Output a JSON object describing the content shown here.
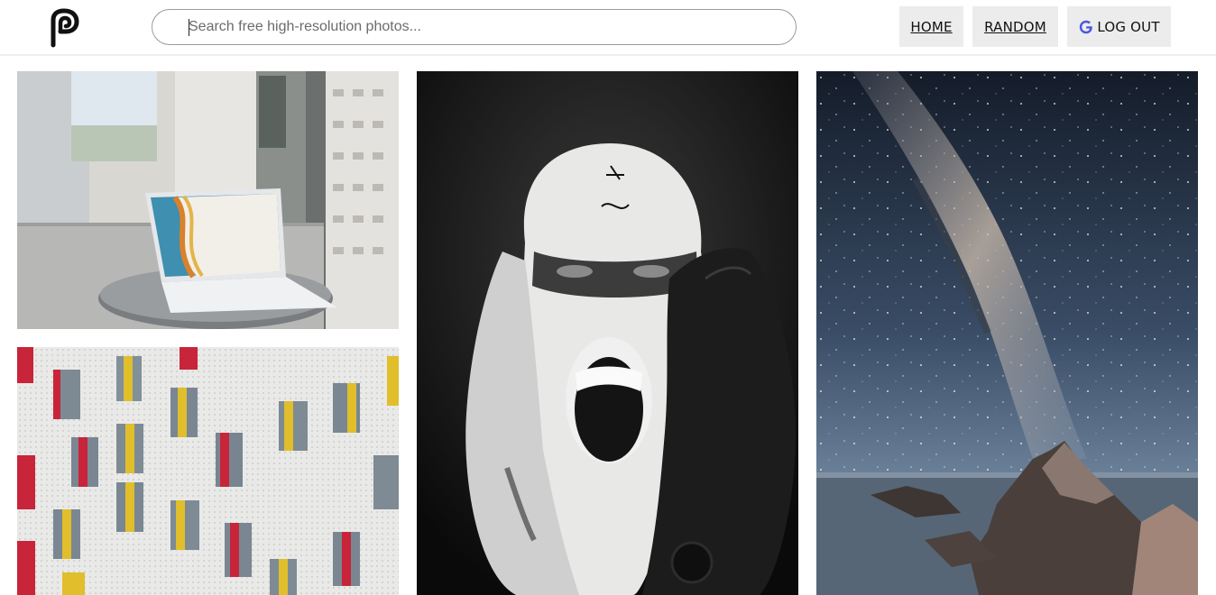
{
  "header": {
    "logo_icon": "p-letter-logo-icon",
    "search": {
      "placeholder": "Search free high-resolution photos..."
    },
    "nav": {
      "home_label": "HOME",
      "random_label": "RANDOM",
      "logout_label": "LOG OUT",
      "logout_icon": "google-g-icon"
    }
  },
  "gallery": {
    "photos": [
      {
        "subject": "laptop-on-balcony-table"
      },
      {
        "subject": "perforated-facade-colored-windows"
      },
      {
        "subject": "person-in-knit-balaclava-bw"
      },
      {
        "subject": "milky-way-over-rocky-coast"
      }
    ]
  },
  "colors": {
    "google_blue": "#4a56e2",
    "nav_button_bg": "#ececec"
  }
}
